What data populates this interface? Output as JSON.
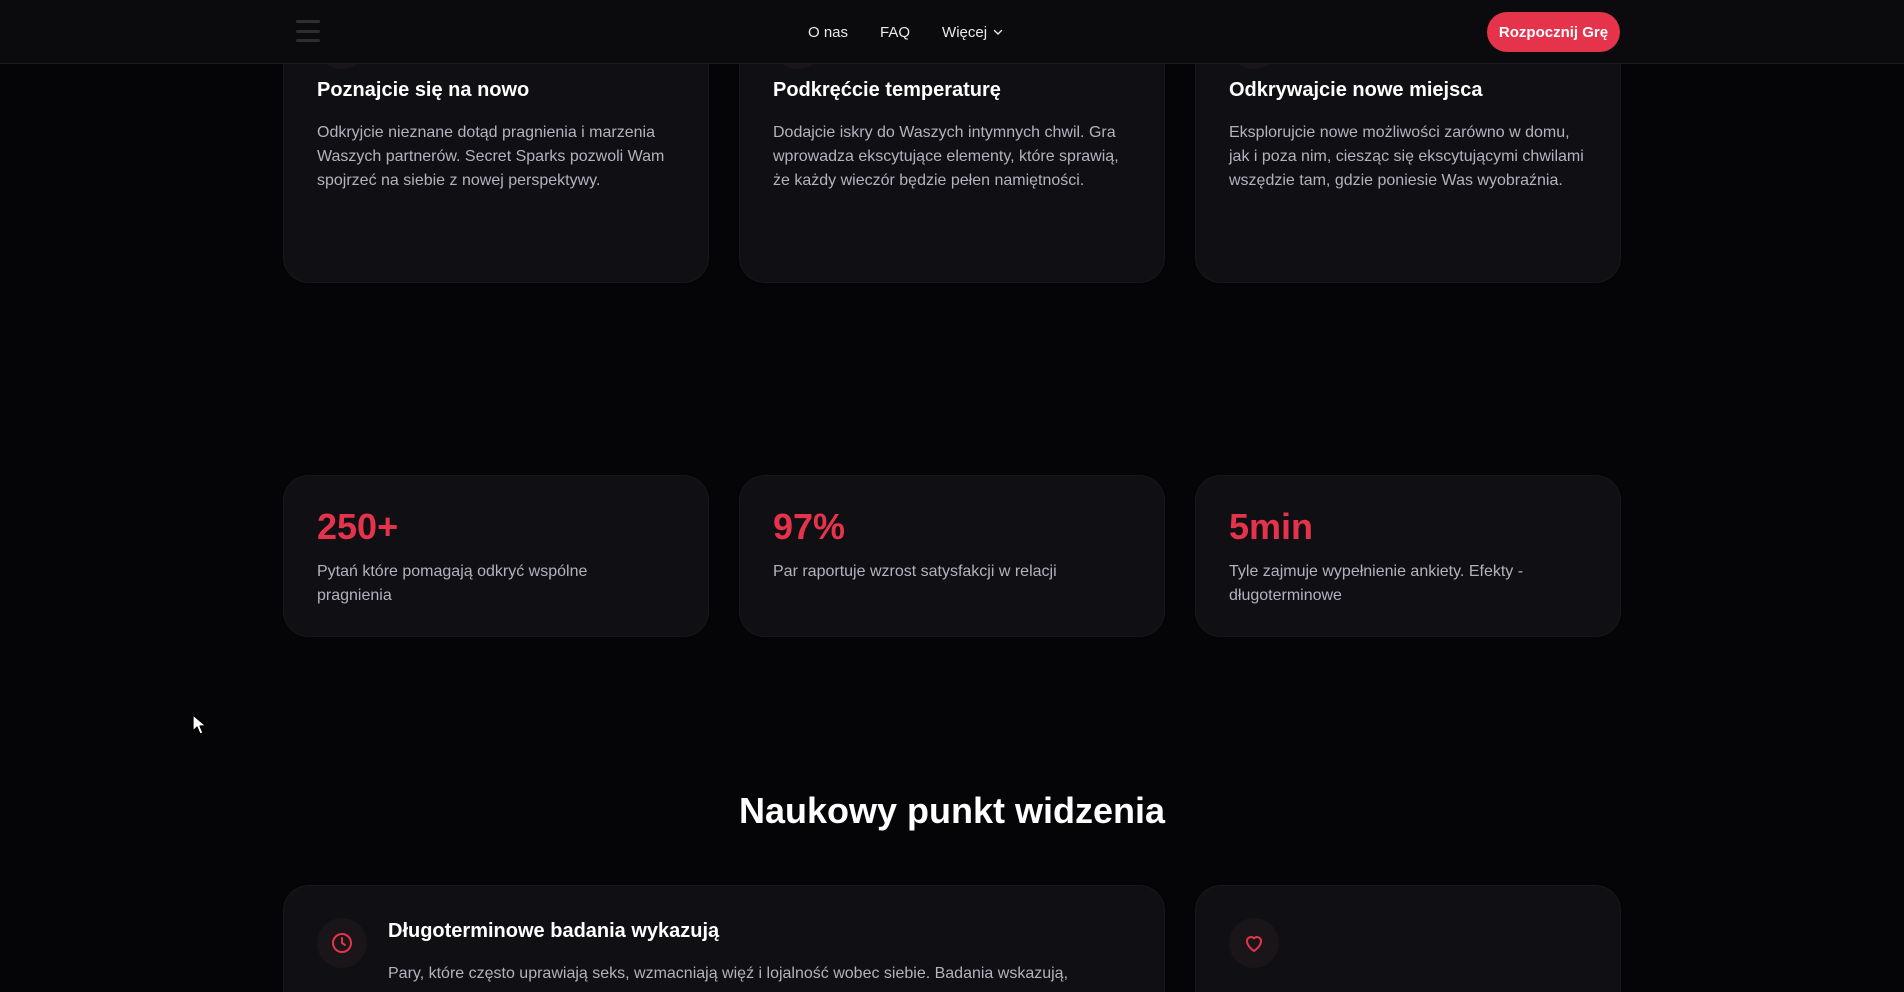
{
  "nav": {
    "links": [
      "O nas",
      "FAQ",
      "Więcej"
    ],
    "cta_label": "Rozpocznij Grę"
  },
  "features": [
    {
      "icon": "heart-pulse-icon",
      "title": "Poznajcie się na nowo",
      "description": "Odkryjcie nieznane dotąd pragnienia i marzenia Waszych partnerów. Secret Sparks pozwoli Wam spojrzeć na siebie z nowej perspektywy."
    },
    {
      "icon": "flame-icon",
      "title": "Podkręćcie temperaturę",
      "description": "Dodajcie iskry do Waszych intymnych chwil. Gra wprowadza ekscytujące elementy, które sprawią, że każdy wieczór będzie pełen namiętności."
    },
    {
      "icon": "compass-icon",
      "title": "Odkrywajcie nowe miejsca",
      "description": "Eksplorujcie nowe możliwości zarówno w domu, jak i poza nim, ciesząc się ekscytującymi chwilami wszędzie tam, gdzie poniesie Was wyobraźnia."
    }
  ],
  "stats": [
    {
      "value": "250+",
      "description": "Pytań które pomagają odkryć wspólne pragnienia"
    },
    {
      "value": "97%",
      "description": "Par raportuje wzrost satysfakcji w relacji"
    },
    {
      "value": "5min",
      "description": "Tyle zajmuje wypełnienie ankiety. Efekty - długoterminowe"
    }
  ],
  "science": {
    "title": "Naukowy punkt widzenia",
    "cards": [
      {
        "icon": "clock-icon",
        "title": "Długoterminowe badania wykazują",
        "description": "Pary, które często uprawiają seks, wzmacniają więź i lojalność wobec siebie. Badania wskazują,"
      },
      {
        "icon": "heart-icon"
      }
    ]
  },
  "colors": {
    "accent": "#e6334c",
    "background": "#050508",
    "card": "#0f0f14",
    "text_muted": "#b3b3bd"
  }
}
